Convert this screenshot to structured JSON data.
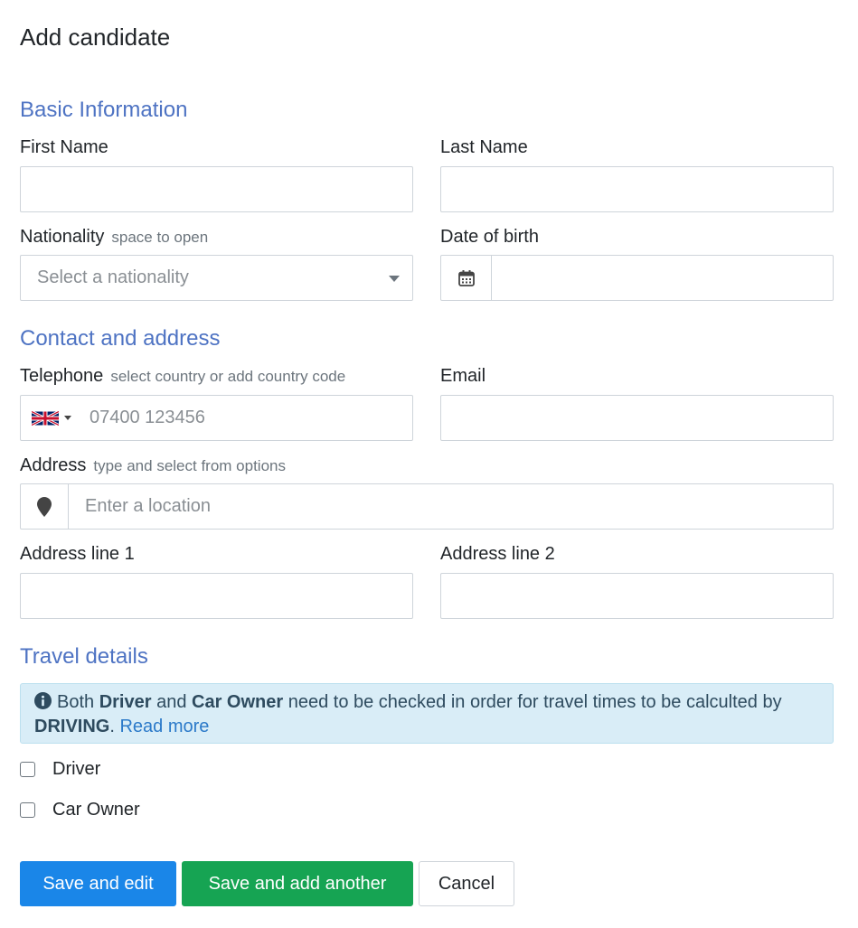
{
  "page": {
    "title": "Add candidate"
  },
  "sections": {
    "basic": "Basic Information",
    "contact": "Contact and address",
    "travel": "Travel details"
  },
  "fields": {
    "first_name": {
      "label": "First Name",
      "value": ""
    },
    "last_name": {
      "label": "Last Name",
      "value": ""
    },
    "nationality": {
      "label": "Nationality",
      "hint": "space to open",
      "placeholder": "Select a nationality"
    },
    "dob": {
      "label": "Date of birth",
      "value": ""
    },
    "telephone": {
      "label": "Telephone",
      "hint": "select country or add country code",
      "placeholder": "07400 123456",
      "country": "GB"
    },
    "email": {
      "label": "Email",
      "value": ""
    },
    "address": {
      "label": "Address",
      "hint": "type and select from options",
      "placeholder": "Enter a location"
    },
    "address_line1": {
      "label": "Address line 1",
      "value": ""
    },
    "address_line2": {
      "label": "Address line 2",
      "value": ""
    }
  },
  "alert": {
    "text_1": "Both ",
    "bold_1": "Driver",
    "text_2": " and ",
    "bold_2": "Car Owner",
    "text_3": " need to be checked in order for travel times to be calculted by ",
    "bold_3": "DRIVING",
    "text_4": ". ",
    "link": "Read more",
    "icon": "info-circle-icon"
  },
  "checkboxes": {
    "driver": {
      "label": "Driver",
      "checked": false
    },
    "car_owner": {
      "label": "Car Owner",
      "checked": false
    }
  },
  "buttons": {
    "save_edit": "Save and edit",
    "save_add": "Save and add another",
    "cancel": "Cancel"
  },
  "colors": {
    "section": "#4e73c3",
    "primary": "#1a86e8",
    "success": "#16a453",
    "alert_bg": "#d9edf7"
  }
}
